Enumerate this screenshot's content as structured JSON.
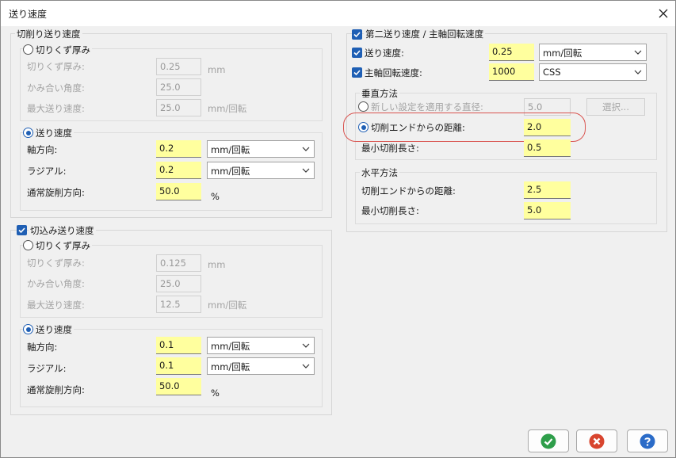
{
  "window": {
    "title": "送り速度"
  },
  "left": {
    "cutting_feed": {
      "legend": "切削り送り速度",
      "chip_mode": {
        "label": "切りくず厚み",
        "selected": false,
        "chip_thickness": {
          "label": "切りくず厚み:",
          "value": "0.25",
          "unit": "mm"
        },
        "engagement_angle": {
          "label": "かみ合い角度:",
          "value": "25.0"
        },
        "max_feed": {
          "label": "最大送り速度:",
          "value": "25.0",
          "unit": "mm/回転"
        }
      },
      "feed_mode": {
        "label": "送り速度",
        "selected": true,
        "axial": {
          "label": "軸方向:",
          "value": "0.2",
          "unit": "mm/回転"
        },
        "radial": {
          "label": "ラジアル:",
          "value": "0.2",
          "unit": "mm/回転"
        },
        "normal_turning": {
          "label": "通常旋削方向:",
          "value": "50.0",
          "unit": "%"
        }
      }
    },
    "plunge_feed": {
      "legend": "切込み送り速度",
      "checked": true,
      "chip_mode": {
        "label": "切りくず厚み",
        "selected": false,
        "chip_thickness": {
          "label": "切りくず厚み:",
          "value": "0.125",
          "unit": "mm"
        },
        "engagement_angle": {
          "label": "かみ合い角度:",
          "value": "25.0"
        },
        "max_feed": {
          "label": "最大送り速度:",
          "value": "12.5",
          "unit": "mm/回転"
        }
      },
      "feed_mode": {
        "label": "送り速度",
        "selected": true,
        "axial": {
          "label": "軸方向:",
          "value": "0.1",
          "unit": "mm/回転"
        },
        "radial": {
          "label": "ラジアル:",
          "value": "0.1",
          "unit": "mm/回転"
        },
        "normal_turning": {
          "label": "通常旋削方向:",
          "value": "50.0",
          "unit": "%"
        }
      }
    }
  },
  "right": {
    "legend": "第二送り速度 / 主軸回転速度",
    "checked": true,
    "feed": {
      "label": "送り速度:",
      "checked": true,
      "value": "0.25",
      "unit": "mm/回転"
    },
    "spindle": {
      "label": "主軸回転速度:",
      "checked": true,
      "value": "1000",
      "unit": "CSS"
    },
    "vertical": {
      "legend": "垂直方法",
      "new_setting": {
        "label": "新しい設定を適用する直径:",
        "selected": false,
        "value": "5.0",
        "button": "選択..."
      },
      "cut_end_distance": {
        "label": "切削エンドからの距離:",
        "selected": true,
        "value": "2.0"
      },
      "min_cut_length": {
        "label": "最小切削長さ:",
        "value": "0.5"
      }
    },
    "horizontal": {
      "legend": "水平方法",
      "cut_end_distance": {
        "label": "切削エンドからの距離:",
        "value": "2.5"
      },
      "min_cut_length": {
        "label": "最小切削長さ:",
        "value": "5.0"
      }
    }
  },
  "buttons": {
    "ok": "ok-icon",
    "cancel": "cancel-icon",
    "help": "help-icon"
  },
  "colors": {
    "accent": "#1f5fb4",
    "input_highlight": "#ffff9e",
    "annotation": "#d9534f",
    "ok": "#2e9e4a",
    "cancel": "#d8452e",
    "help": "#2a6bc8"
  }
}
